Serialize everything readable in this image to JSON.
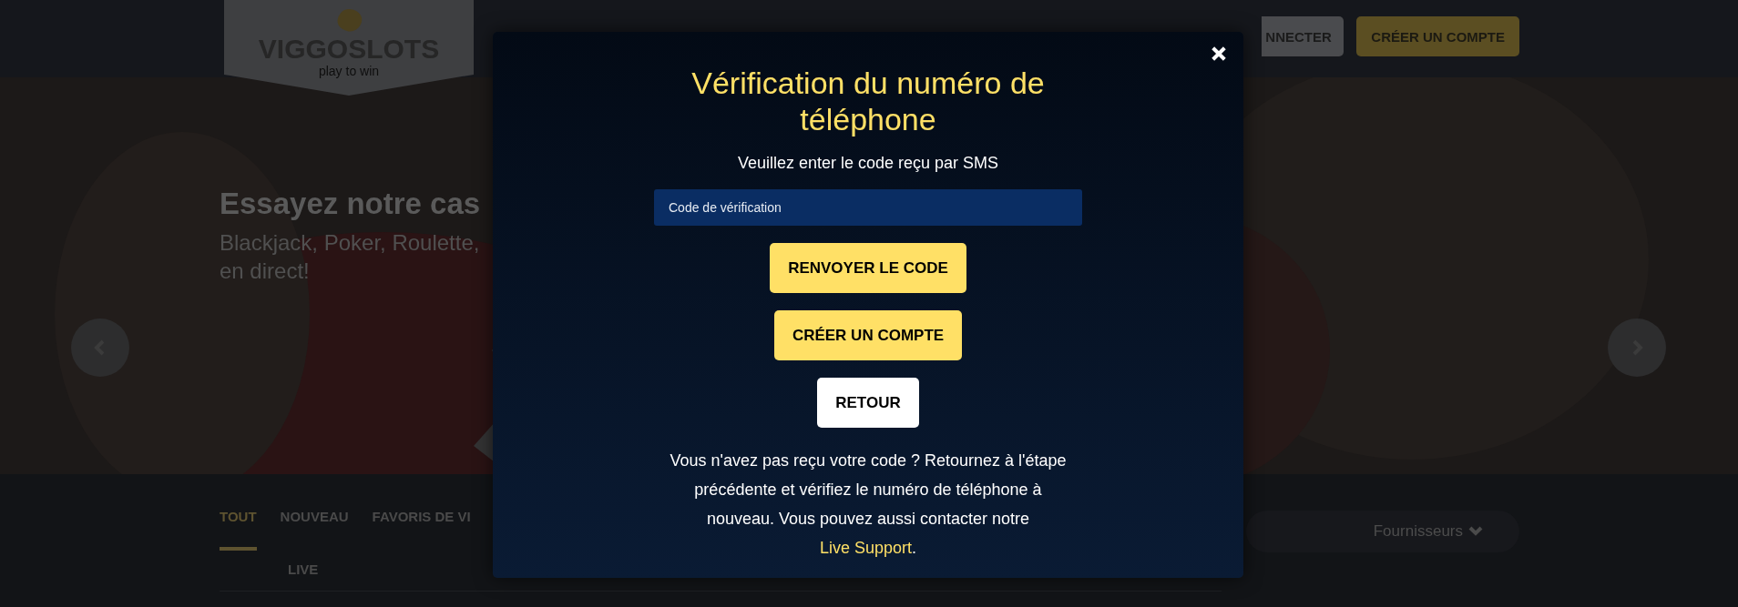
{
  "header": {
    "logo": {
      "name": "VIGGOSLOTS",
      "tagline": "play to win"
    },
    "buttons": [
      {
        "label": "NNECTER",
        "kind": "secondary"
      },
      {
        "label": "CRÉER UN COMPTE",
        "kind": "primary"
      }
    ]
  },
  "hero": {
    "title": "Essayez notre cas",
    "subtitle_lines": [
      "Blackjack, Poker, Roulette,",
      "en direct!"
    ]
  },
  "tab_rows": [
    [
      {
        "label": "TOUT",
        "selected": true
      },
      {
        "label": "NOUVEAU",
        "selected": false
      },
      {
        "label": "FAVORIS DE VI",
        "selected": false
      }
    ],
    [
      {
        "label": "LIVE",
        "selected": false
      }
    ]
  ],
  "providers_dropdown": {
    "label": "Fournisseurs"
  },
  "modal": {
    "title": "Vérification du numéro de téléphone",
    "subtitle": "Veuillez enter le code reçu par SMS",
    "code_field": {
      "placeholder": "Code de vérification"
    },
    "buttons": [
      {
        "label": "RENVOYER LE CODE",
        "kind": "primary"
      },
      {
        "label": "CRÉER UN COMPTE",
        "kind": "primary"
      },
      {
        "label": "RETOUR",
        "kind": "secondary"
      }
    ],
    "help_text": "Vous n'avez pas reçu votre code ? Retournez à l'étape précédente et vérifiez le numéro de téléphone à nouveau. Vous pouvez aussi contacter notre",
    "help_link": "Live Support",
    "help_end": "."
  }
}
